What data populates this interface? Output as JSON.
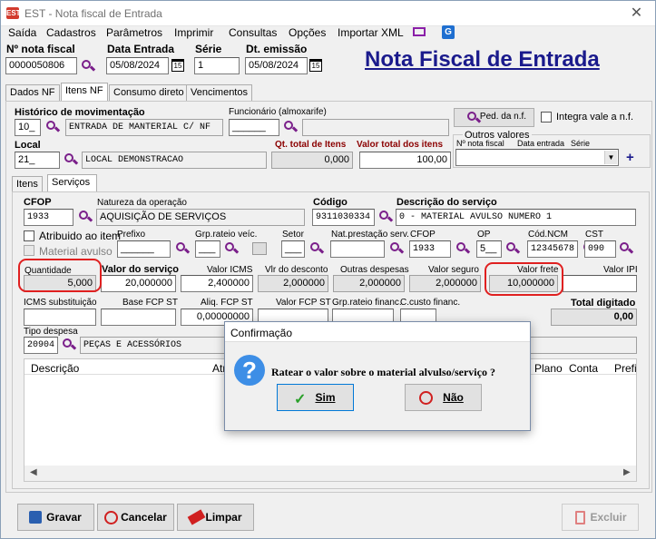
{
  "window": {
    "app_code": "EST",
    "title": "EST - Nota fiscal de Entrada",
    "close": "✕"
  },
  "menu": [
    "Saída",
    "Cadastros",
    "Parâmetros",
    "Imprimir",
    "Consultas",
    "Opções",
    "Importar XML"
  ],
  "header": {
    "nf_label": "Nº nota fiscal",
    "nf_value": "0000050806",
    "data_entrada_label": "Data Entrada",
    "data_entrada_value": "05/08/2024",
    "serie_label": "Série",
    "serie_value": "1",
    "dt_emissao_label": "Dt. emissão",
    "dt_emissao_value": "05/08/2024",
    "big_title": "Nota Fiscal de Entrada",
    "cal_glyph": "15"
  },
  "tabs": [
    "Dados NF",
    "Itens NF",
    "Consumo direto",
    "Vencimentos"
  ],
  "itens": {
    "historico_label": "Histórico de movimentação",
    "historico_code": "10_",
    "historico_desc": "ENTRADA DE MANTERIAL C/ NF",
    "funcionario_label": "Funcionário (almoxarife)",
    "funcionario_value": "______",
    "ped_button": "Ped. da n.f.",
    "integra_label": "Integra vale a n.f.",
    "outros_label": "Outros valores",
    "nf_col": "Nº nota fiscal",
    "data_col": "Data entrada",
    "serie_col": "Série",
    "local_label": "Local",
    "local_code": "21_",
    "local_desc": "LOCAL DEMONSTRACAO",
    "qt_total_label": "Qt. total de Itens",
    "qt_total_value": "0,000",
    "valor_total_label": "Valor total dos itens",
    "valor_total_value": "100,00",
    "plus": "+"
  },
  "subtabs": [
    "Itens",
    "Serviços"
  ],
  "servicos": {
    "cfop_label": "CFOP",
    "cfop_value": "1933",
    "natureza_label": "Natureza da operação",
    "natureza_value": "AQUISIÇÃO DE SERVIÇOS",
    "codigo_label": "Código",
    "codigo_value": "9311030334",
    "descricao_label": "Descrição do serviço",
    "descricao_value": "0 - MATERIAL AVULSO NUMERO 1",
    "atribuido_label": "Atribuido ao item",
    "material_label": "Material avulso",
    "prefixo_label": "Prefixo",
    "prefixo_value": "______",
    "grp_rateio_label": "Grp.rateio veíc.",
    "grp_rateio_value": "___",
    "setor_label": "Setor",
    "setor_value": "___",
    "nat_prest_label": "Nat.prestação serv.",
    "cfop2_label": "CFOP",
    "cfop2_value": "1933",
    "op_label": "OP",
    "op_value": "5__",
    "ncm_label": "Cód.NCM",
    "ncm_value": "12345678",
    "cst_label": "CST",
    "cst_value": "090",
    "quantidade_label": "Quantidade",
    "quantidade_value": "5,000",
    "valor_servico_label": "Valor do serviço",
    "valor_servico_value": "20,000000",
    "valor_icms_label": "Valor ICMS",
    "valor_icms_value": "2,400000",
    "vlr_desconto_label": "Vlr do desconto",
    "vlr_desconto_value": "2,000000",
    "outras_label": "Outras despesas",
    "outras_value": "2,000000",
    "seguro_label": "Valor seguro",
    "seguro_value": "2,000000",
    "frete_label": "Valor frete",
    "frete_value": "10,000000",
    "ipi_label": "Valor IPI",
    "icms_sub_label": "ICMS substituição",
    "base_fcp_label": "Base FCP ST",
    "aliq_fcp_label": "Aliq. FCP ST",
    "aliq_fcp_value": "0,00000000",
    "valor_fcp_label": "Valor FCP ST",
    "grp_fin_label": "Grp.rateio financ.",
    "custo_fin_label": "C.custo financ.",
    "total_digitado_label": "Total digitado",
    "total_digitado_value": "0,00",
    "tipo_despesa_label": "Tipo despesa",
    "tipo_despesa_code": "20904",
    "tipo_despesa_desc": "PEÇAS E ACESSÓRIOS",
    "columns": [
      "Descrição",
      "Atr",
      "Plano",
      "Conta",
      "Prefi"
    ]
  },
  "dialog": {
    "title": "Confirmação",
    "icon": "?",
    "message": "Ratear o valor sobre o material alvulso/serviço ?",
    "yes": "Sim",
    "no": "Não"
  },
  "footer": {
    "gravar": "Gravar",
    "cancelar": "Cancelar",
    "limpar": "Limpar",
    "excluir": "Excluir"
  }
}
